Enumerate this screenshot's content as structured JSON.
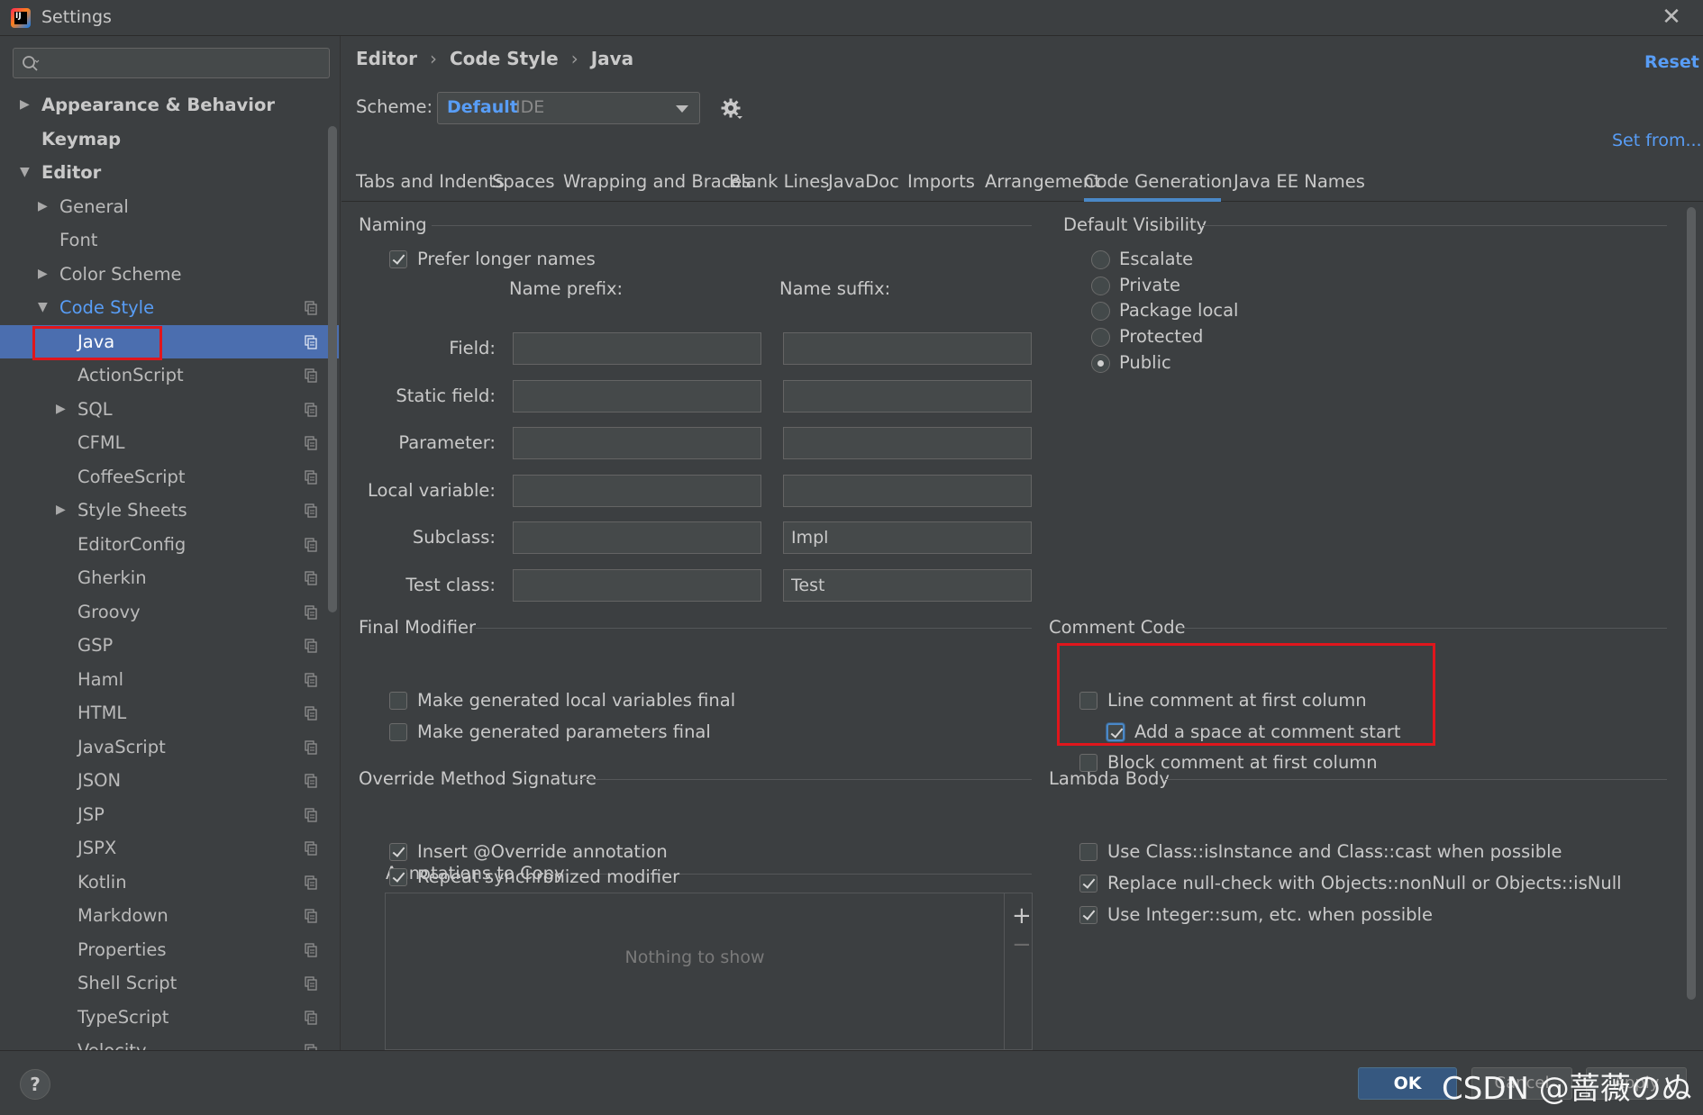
{
  "window": {
    "title": "Settings",
    "icon_text": "IJ",
    "close_glyph": "✕"
  },
  "search": {
    "placeholder": "",
    "value": ""
  },
  "sidebar": {
    "items": [
      {
        "label": "Appearance & Behavior",
        "arrow": "▶"
      },
      {
        "label": "Keymap",
        "arrow": ""
      },
      {
        "label": "Editor",
        "arrow": "▼"
      },
      {
        "label": "General",
        "arrow": "▶"
      },
      {
        "label": "Font",
        "arrow": ""
      },
      {
        "label": "Color Scheme",
        "arrow": "▶"
      },
      {
        "label": "Code Style",
        "arrow": "▼"
      },
      {
        "label": "Java",
        "arrow": ""
      },
      {
        "label": "ActionScript",
        "arrow": ""
      },
      {
        "label": "SQL",
        "arrow": "▶"
      },
      {
        "label": "CFML",
        "arrow": ""
      },
      {
        "label": "CoffeeScript",
        "arrow": ""
      },
      {
        "label": "Style Sheets",
        "arrow": "▶"
      },
      {
        "label": "EditorConfig",
        "arrow": ""
      },
      {
        "label": "Gherkin",
        "arrow": ""
      },
      {
        "label": "Groovy",
        "arrow": ""
      },
      {
        "label": "GSP",
        "arrow": ""
      },
      {
        "label": "Haml",
        "arrow": ""
      },
      {
        "label": "HTML",
        "arrow": ""
      },
      {
        "label": "JavaScript",
        "arrow": ""
      },
      {
        "label": "JSON",
        "arrow": ""
      },
      {
        "label": "JSP",
        "arrow": ""
      },
      {
        "label": "JSPX",
        "arrow": ""
      },
      {
        "label": "Kotlin",
        "arrow": ""
      },
      {
        "label": "Markdown",
        "arrow": ""
      },
      {
        "label": "Properties",
        "arrow": ""
      },
      {
        "label": "Shell Script",
        "arrow": ""
      },
      {
        "label": "TypeScript",
        "arrow": ""
      },
      {
        "label": "Velocity",
        "arrow": ""
      }
    ]
  },
  "header": {
    "breadcrumb": [
      "Editor",
      "Code Style",
      "Java"
    ],
    "breadcrumb_sep": "›",
    "reset_label": "Reset",
    "scheme_label": "Scheme:",
    "scheme_name": "Default",
    "scheme_type": "IDE",
    "set_from_label": "Set from..."
  },
  "tabs": [
    {
      "label": "Tabs and Indents",
      "active": false
    },
    {
      "label": "Spaces",
      "active": false
    },
    {
      "label": "Wrapping and Braces",
      "active": false
    },
    {
      "label": "Blank Lines",
      "active": false
    },
    {
      "label": "JavaDoc",
      "active": false
    },
    {
      "label": "Imports",
      "active": false
    },
    {
      "label": "Arrangement",
      "active": false
    },
    {
      "label": "Code Generation",
      "active": true
    },
    {
      "label": "Java EE Names",
      "active": false
    }
  ],
  "naming": {
    "title": "Naming",
    "prefer_longer": {
      "label": "Prefer longer names",
      "checked": true
    },
    "prefix_header": "Name prefix:",
    "suffix_header": "Name suffix:",
    "rows": [
      {
        "label": "Field:",
        "prefix": "",
        "suffix": ""
      },
      {
        "label": "Static field:",
        "prefix": "",
        "suffix": ""
      },
      {
        "label": "Parameter:",
        "prefix": "",
        "suffix": ""
      },
      {
        "label": "Local variable:",
        "prefix": "",
        "suffix": ""
      },
      {
        "label": "Subclass:",
        "prefix": "",
        "suffix": "Impl"
      },
      {
        "label": "Test class:",
        "prefix": "",
        "suffix": "Test"
      }
    ]
  },
  "default_visibility": {
    "title": "Default Visibility",
    "options": [
      {
        "label": "Escalate",
        "checked": false
      },
      {
        "label": "Private",
        "checked": false
      },
      {
        "label": "Package local",
        "checked": false
      },
      {
        "label": "Protected",
        "checked": false
      },
      {
        "label": "Public",
        "checked": true
      }
    ]
  },
  "final_modifier": {
    "title": "Final Modifier",
    "options": [
      {
        "label": "Make generated local variables final",
        "checked": false
      },
      {
        "label": "Make generated parameters final",
        "checked": false
      }
    ]
  },
  "comment_code": {
    "title": "Comment Code",
    "options": [
      {
        "label": "Line comment at first column",
        "checked": false
      },
      {
        "label": "Add a space at comment start",
        "checked": true
      },
      {
        "label": "Block comment at first column",
        "checked": false
      }
    ]
  },
  "override_method": {
    "title": "Override Method Signature",
    "options": [
      {
        "label": "Insert @Override annotation",
        "checked": true
      },
      {
        "label": "Repeat synchronized modifier",
        "checked": true
      }
    ],
    "annotations_title": "Annotations to Copy",
    "empty_text": "Nothing to show",
    "add_glyph": "+",
    "remove_glyph": "−"
  },
  "lambda_body": {
    "title": "Lambda Body",
    "options": [
      {
        "label": "Use Class::isInstance and Class::cast when possible",
        "checked": false
      },
      {
        "label": "Replace null-check with Objects::nonNull or Objects::isNull",
        "checked": true
      },
      {
        "label": "Use Integer::sum, etc. when possible",
        "checked": true
      }
    ]
  },
  "footer": {
    "help_label": "?",
    "ok_label": "OK",
    "cancel_label": "Cancel",
    "apply_label": "Apply",
    "watermark": "CSDN @蔷薇のぬ"
  },
  "colors": {
    "accent": "#589df6",
    "selection": "#4b6eaf",
    "highlight_box": "#e0161c",
    "ok_button": "#365880"
  }
}
